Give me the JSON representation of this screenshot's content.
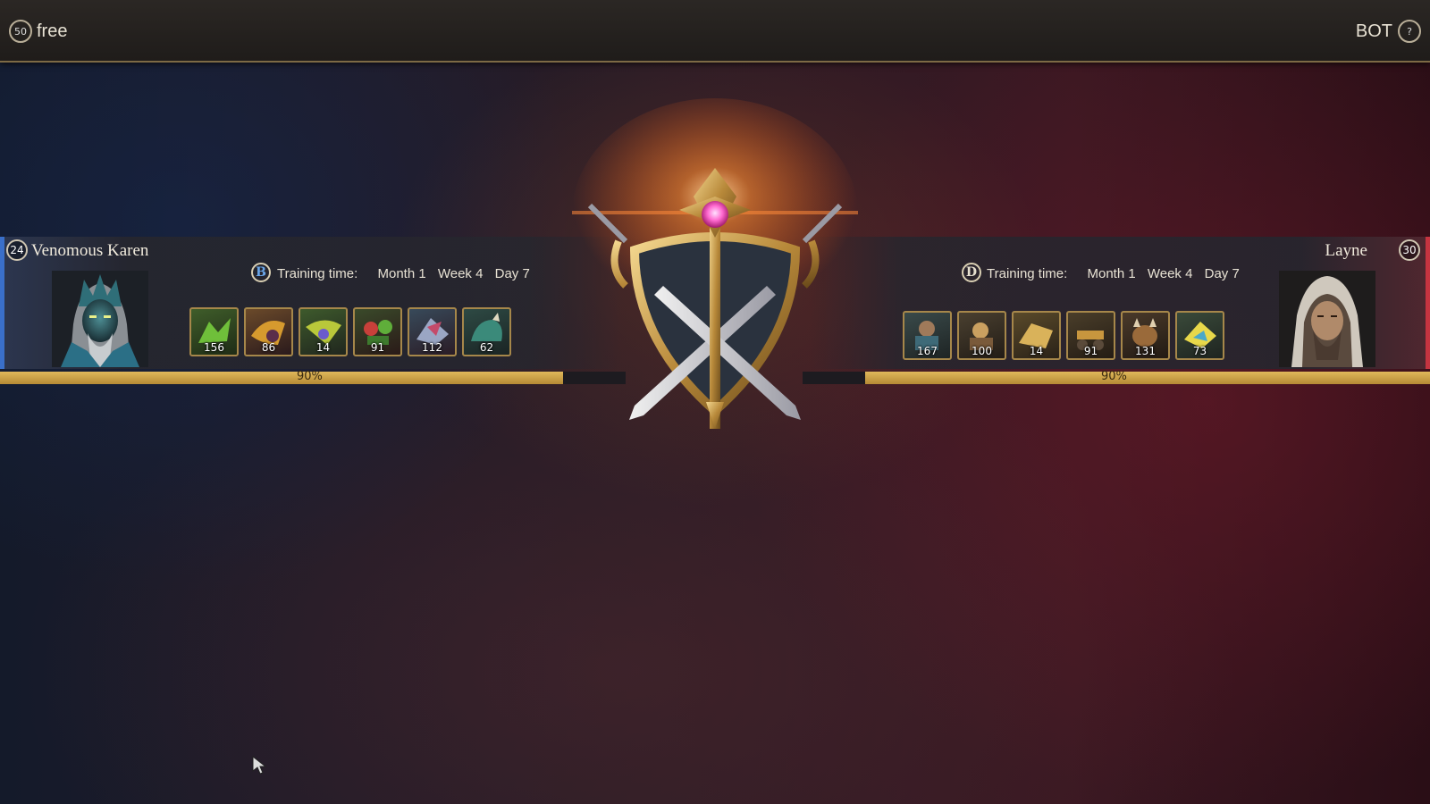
{
  "topbar": {
    "left_coin": "50",
    "left_label": "free",
    "right_label": "BOT",
    "right_icon": "?"
  },
  "left_player": {
    "level": "24",
    "name": "Venomous Karen",
    "grade": "B",
    "training_label": "Training time:",
    "month": "Month 1",
    "week": "Week 4",
    "day": "Day 7",
    "units": [
      "156",
      "86",
      "14",
      "91",
      "112",
      "62"
    ],
    "hp_percent": 90,
    "hp_label": "90%",
    "accent": "#3a6fc9"
  },
  "right_player": {
    "level": "30",
    "name": "Layne",
    "grade": "D",
    "training_label": "Training time:",
    "month": "Month 1",
    "week": "Week 4",
    "day": "Day 7",
    "units": [
      "167",
      "100",
      "14",
      "91",
      "131",
      "73"
    ],
    "hp_percent": 90,
    "hp_label": "90%",
    "accent": "#c53440"
  }
}
